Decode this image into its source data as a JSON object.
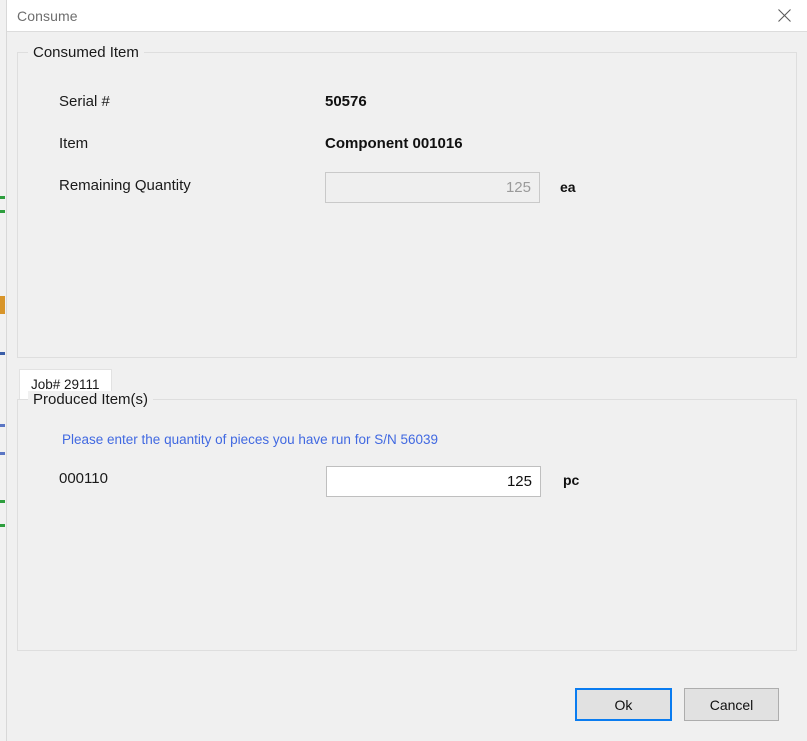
{
  "window": {
    "title": "Consume",
    "close_icon": "close-icon"
  },
  "consumed_group": {
    "legend": "Consumed Item",
    "fields": [
      {
        "label": "Serial #",
        "value": "50576"
      },
      {
        "label": "Item",
        "value": "Component 001016"
      }
    ],
    "remaining": {
      "label": "Remaining Quantity",
      "value": "125",
      "unit": "ea"
    }
  },
  "tabs": [
    {
      "label": "Job# 29111",
      "selected": true
    }
  ],
  "produced_group": {
    "legend": "Produced Item(s)",
    "hint": "Please enter the quantity of pieces you have run for S/N 56039",
    "row": {
      "item_label": "000110",
      "value": "125",
      "unit": "pc"
    }
  },
  "footer": {
    "ok_label": "Ok",
    "cancel_label": "Cancel"
  },
  "colors": {
    "dialog_background": "#f0f0f0",
    "titlebar_background": "#ffffff",
    "hint_text": "#4169e1",
    "focus_border": "#0a7cf0",
    "groupbox_border": "#dedede"
  }
}
